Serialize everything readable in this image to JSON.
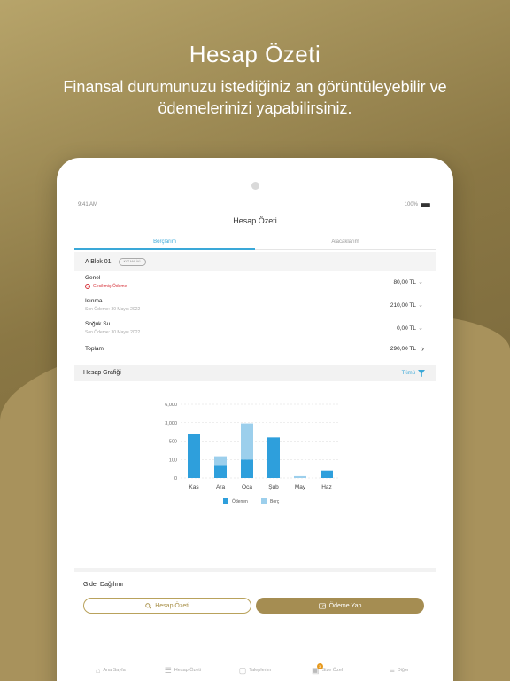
{
  "hero": {
    "title": "Hesap Özeti",
    "subtitle": "Finansal durumunuzu istediğiniz an görüntüleyebilir ve ödemelerinizi yapabilirsiniz."
  },
  "status": {
    "time": "9:41 AM",
    "battery": "100%"
  },
  "screen": {
    "title": "Hesap Özeti"
  },
  "tabs": [
    {
      "label": "Borçlarım",
      "active": true
    },
    {
      "label": "Alacaklarım",
      "active": false
    }
  ],
  "block": {
    "name": "A Blok 01",
    "badge": "KAT MALİKİ"
  },
  "items": [
    {
      "name": "Genel",
      "sub": "Gecikmiş Ödeme",
      "warning": true,
      "amount": "80,00 TL"
    },
    {
      "name": "Isınma",
      "sub": "Son Ödeme: 30 Mayıs 2022",
      "warning": false,
      "amount": "210,00 TL"
    },
    {
      "name": "Soğuk Su",
      "sub": "Son Ödeme: 30 Mayıs 2022",
      "warning": false,
      "amount": "0,00 TL"
    }
  ],
  "total": {
    "label": "Toplam",
    "amount": "290,00 TL"
  },
  "graph": {
    "title": "Hesap Grafiği",
    "filter_label": "Tümü"
  },
  "chart_data": {
    "type": "bar",
    "stacked": true,
    "categories": [
      "Kas",
      "Ara",
      "Oca",
      "Şub",
      "May",
      "Haz"
    ],
    "y_ticks": [
      "0",
      "100",
      "500",
      "3,000",
      "6,000"
    ],
    "y_tick_values": [
      0,
      100,
      500,
      3000,
      6000
    ],
    "series": [
      {
        "name": "Ödenen",
        "color": "#2e9fdc",
        "values": [
          1500,
          70,
          100,
          1000,
          0,
          40
        ]
      },
      {
        "name": "Borç",
        "color": "#9ccfec",
        "values": [
          0,
          100,
          2800,
          0,
          10,
          0
        ]
      }
    ],
    "grid": true,
    "legend": "bottom-center"
  },
  "gider": {
    "title": "Gider Dağılımı"
  },
  "buttons": {
    "summary": "Hesap Özeti",
    "pay": "Ödeme Yap"
  },
  "tabbar": [
    {
      "label": "Ana Sayfa",
      "icon": "home-icon"
    },
    {
      "label": "Hesap Özeti",
      "icon": "document-icon"
    },
    {
      "label": "Taleplerim",
      "icon": "request-icon"
    },
    {
      "label": "Size Özel",
      "icon": "gift-icon",
      "badge": "3"
    },
    {
      "label": "Diğer",
      "icon": "menu-icon"
    }
  ],
  "colors": {
    "accent": "#3aa8d8",
    "gold": "#a58d52",
    "warning": "#d6323a"
  }
}
